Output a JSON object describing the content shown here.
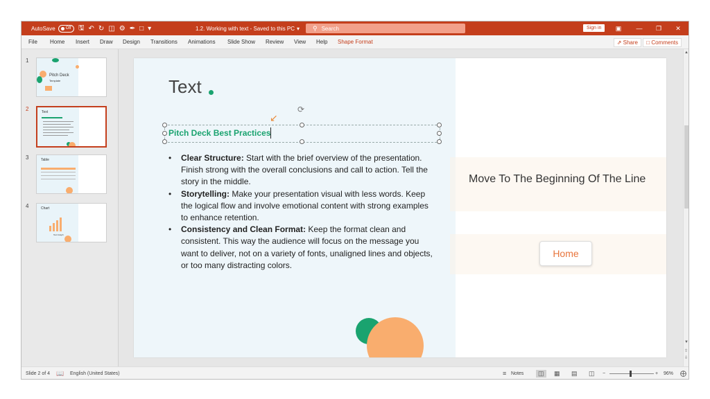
{
  "titlebar": {
    "autosave_label": "AutoSave",
    "autosave_state": "Off",
    "document_title": "1.2. Working with text - Saved to this PC",
    "search_placeholder": "Search",
    "signin_label": "Sign in",
    "accent_color": "#c43e1c"
  },
  "menu": {
    "items": [
      "File",
      "Home",
      "Insert",
      "Draw",
      "Design",
      "Transitions",
      "Animations",
      "Slide Show",
      "Review",
      "View",
      "Help",
      "Shape Format"
    ],
    "active": "Shape Format",
    "share_label": "Share",
    "comments_label": "Comments"
  },
  "thumbnails": [
    {
      "number": "1",
      "text": "Pitch Deck",
      "sub": "Template"
    },
    {
      "number": "2",
      "text": "Text",
      "selected": true
    },
    {
      "number": "3",
      "text": "Table"
    },
    {
      "number": "4",
      "text": "Chart",
      "sub": "Text Graph"
    }
  ],
  "slide": {
    "title": "Text",
    "heading": "Pitch Deck Best Practices",
    "bullets": [
      {
        "bold": "Clear Structure:",
        "text": " Start with the brief overview of the presentation. Finish strong with the overall conclusions and call to action. Tell the story in the middle."
      },
      {
        "bold": "Storytelling:",
        "text": " Make your presentation visual with less words. Keep the logical flow and involve emotional content with strong examples to enhance retention."
      },
      {
        "bold": "Consistency and Clean Format:",
        "text": " Keep the format clean and consistent. This way the audience will focus on the message you want to deliver, not on a variety of fonts, unaligned lines and objects, or too many distracting colors."
      }
    ],
    "heading_color": "#1aa36f"
  },
  "overlay": {
    "shortcut_text": "Move To The Beginning Of The Line",
    "key_label": "Home",
    "key_color": "#e8743b"
  },
  "status": {
    "slide_info": "Slide 2 of 4",
    "language": "English (United States)",
    "notes_label": "Notes",
    "zoom": "96%"
  }
}
